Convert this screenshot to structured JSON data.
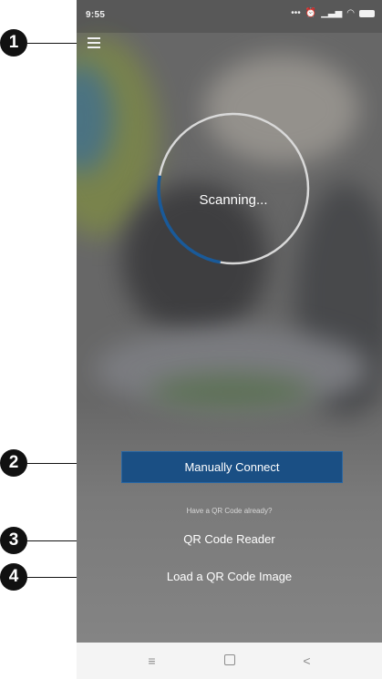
{
  "status_bar": {
    "time": "9:55",
    "icons": [
      "dots-icon",
      "alarm-icon",
      "signal-icon",
      "wifi-icon",
      "battery-icon"
    ]
  },
  "scanner": {
    "status_text": "Scanning...",
    "progress_fraction": 0.25,
    "ring_color": "#d9d9d9",
    "progress_color": "#1a5a99"
  },
  "actions": {
    "manual_connect_label": "Manually Connect",
    "qr_hint": "Have a QR Code already?",
    "qr_reader_label": "QR Code Reader",
    "load_qr_label": "Load a QR Code Image"
  },
  "nav_bar": {
    "menu_glyph": "≡",
    "back_glyph": "<"
  },
  "callouts": [
    {
      "number": "1",
      "target": "menu"
    },
    {
      "number": "2",
      "target": "manual-connect"
    },
    {
      "number": "3",
      "target": "qr-code-reader"
    },
    {
      "number": "4",
      "target": "load-qr-code-image"
    }
  ],
  "colors": {
    "accent": "#1a4f84",
    "callout": "#111111"
  }
}
